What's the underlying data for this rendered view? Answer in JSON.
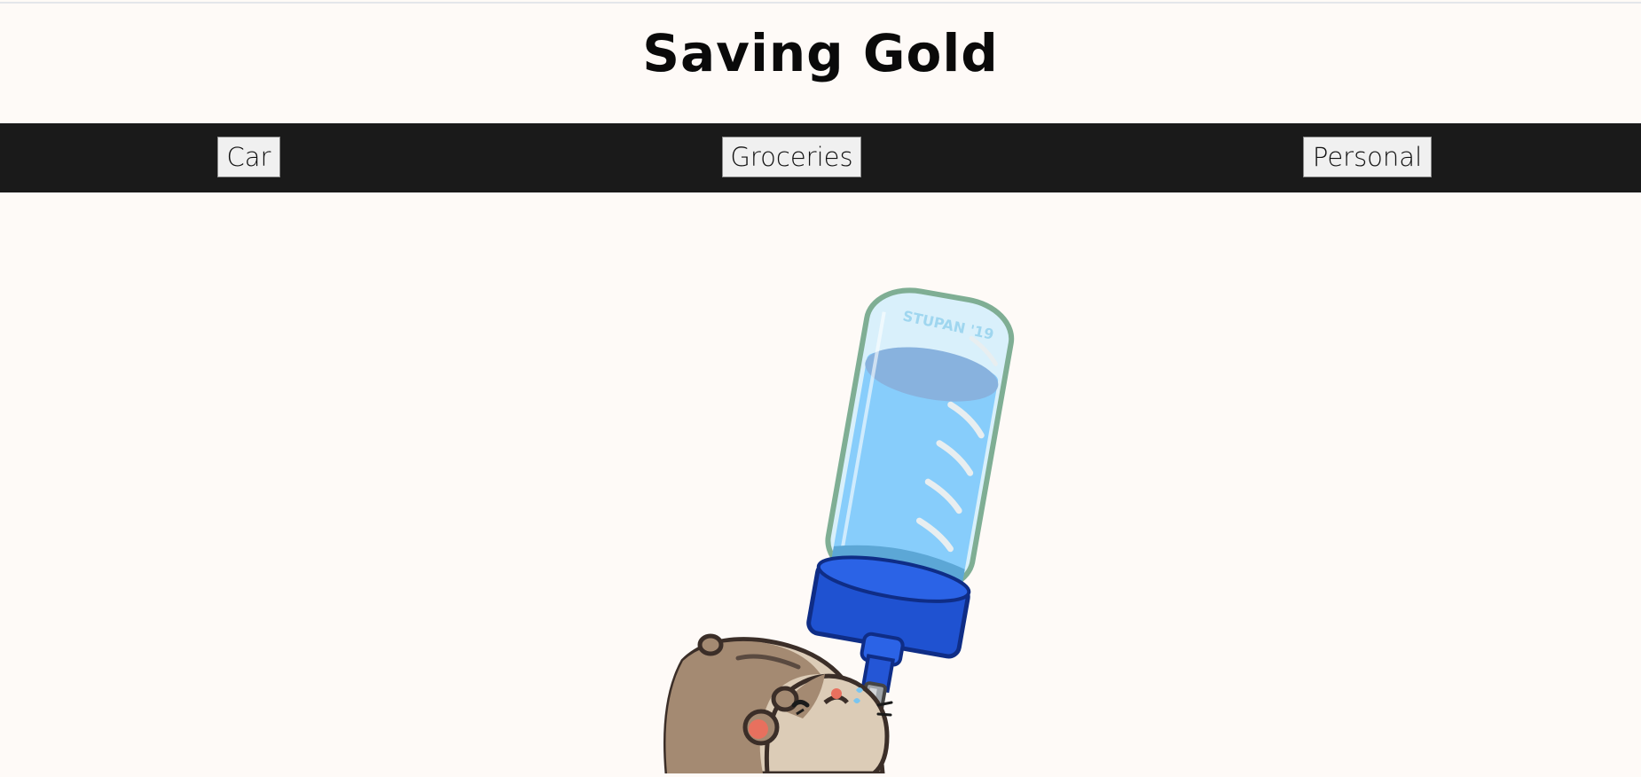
{
  "header": {
    "title": "Saving Gold"
  },
  "nav": {
    "buttons": [
      {
        "label": "Car"
      },
      {
        "label": "Groceries"
      },
      {
        "label": "Personal"
      }
    ]
  },
  "illustration": {
    "subject": "hamster drinking from water bottle",
    "signature": "STUPAN '19"
  },
  "colors": {
    "background": "#fefaf7",
    "nav_bar": "#1a1a1a",
    "button_bg": "#f0f0f0",
    "title_text": "#0a0a0a"
  }
}
